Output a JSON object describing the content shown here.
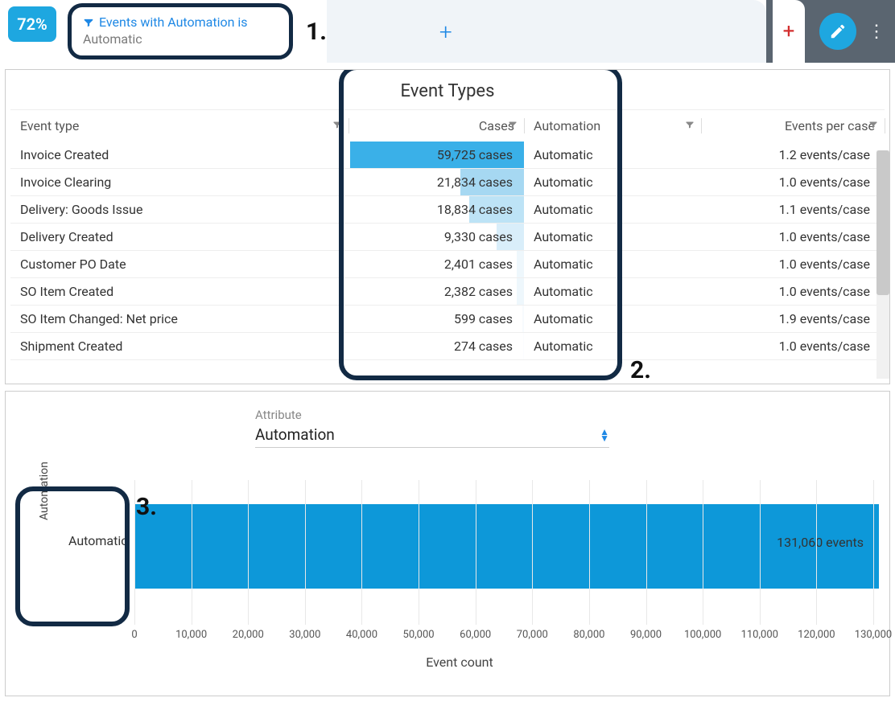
{
  "topbar": {
    "percent": "72%",
    "filter_title": "Events with Automation is",
    "filter_value": "Automatic"
  },
  "annotations": {
    "a1": "1.",
    "a2": "2.",
    "a3": "3."
  },
  "table": {
    "title": "Event Types",
    "headers": {
      "event_type": "Event type",
      "cases": "Cases",
      "automation": "Automation",
      "events_per_case": "Events per case"
    },
    "max_cases": 59725,
    "rows": [
      {
        "event_type": "Invoice Created",
        "cases_raw": 59725,
        "cases": "59,725 cases",
        "automation": "Automatic",
        "epc": "1.2 events/case",
        "bar_color": "#3ab0e8"
      },
      {
        "event_type": "Invoice Clearing",
        "cases_raw": 21834,
        "cases": "21,834 cases",
        "automation": "Automatic",
        "epc": "1.0 events/case",
        "bar_color": "#a6d8f2"
      },
      {
        "event_type": "Delivery: Goods Issue",
        "cases_raw": 18834,
        "cases": "18,834 cases",
        "automation": "Automatic",
        "epc": "1.1 events/case",
        "bar_color": "#bde3f6"
      },
      {
        "event_type": "Delivery Created",
        "cases_raw": 9330,
        "cases": "9,330 cases",
        "automation": "Automatic",
        "epc": "1.0 events/case",
        "bar_color": "#d9eefa"
      },
      {
        "event_type": "Customer PO Date",
        "cases_raw": 2401,
        "cases": "2,401 cases",
        "automation": "Automatic",
        "epc": "1.0 events/case",
        "bar_color": "#eef7fc"
      },
      {
        "event_type": "SO Item Created",
        "cases_raw": 2382,
        "cases": "2,382 cases",
        "automation": "Automatic",
        "epc": "1.0 events/case",
        "bar_color": "#eef7fc"
      },
      {
        "event_type": "SO Item Changed: Net price",
        "cases_raw": 599,
        "cases": "599 cases",
        "automation": "Automatic",
        "epc": "1.9 events/case",
        "bar_color": "#f7fbfe"
      },
      {
        "event_type": "Shipment Created",
        "cases_raw": 274,
        "cases": "274 cases",
        "automation": "Automatic",
        "epc": "1.0 events/case",
        "bar_color": "#fbfdff"
      }
    ]
  },
  "chart": {
    "attribute_label": "Attribute",
    "attribute_value": "Automation",
    "y_title": "Automation",
    "y_category": "Automatic",
    "bar_label": "131,060 events",
    "x_title": "Event count",
    "x_ticks": [
      "0",
      "10,000",
      "20,000",
      "30,000",
      "40,000",
      "50,000",
      "60,000",
      "70,000",
      "80,000",
      "90,000",
      "100,000",
      "110,000",
      "120,000",
      "130,000"
    ]
  },
  "chart_data": {
    "type": "bar",
    "orientation": "horizontal",
    "title": "",
    "xlabel": "Event count",
    "ylabel": "Automation",
    "xlim": [
      0,
      130000
    ],
    "categories": [
      "Automatic"
    ],
    "values": [
      131060
    ]
  }
}
